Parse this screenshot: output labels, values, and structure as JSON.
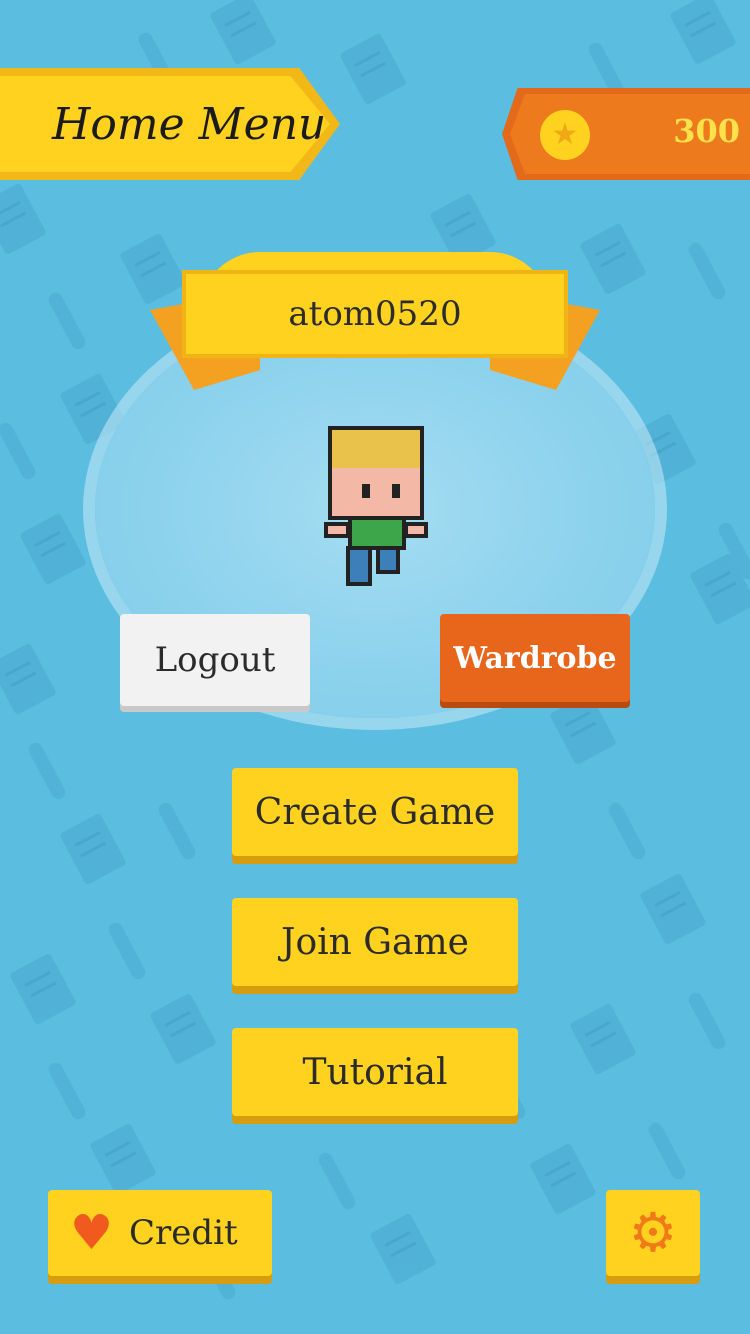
{
  "header": {
    "title": "Home Menu"
  },
  "wallet": {
    "coins": "300",
    "icon": "star-coin-icon"
  },
  "player": {
    "username": "atom0520"
  },
  "profile_buttons": {
    "logout": "Logout",
    "wardrobe": "Wardrobe"
  },
  "menu": {
    "create_game": "Create Game",
    "join_game": "Join Game",
    "tutorial": "Tutorial"
  },
  "footer": {
    "credit": "Credit",
    "credit_icon": "heart-icon",
    "settings_icon": "gear-icon"
  },
  "colors": {
    "background": "#5bbde0",
    "primary_yellow": "#ffd21f",
    "accent_orange": "#e8661c",
    "coin_text": "#ffe14a"
  }
}
